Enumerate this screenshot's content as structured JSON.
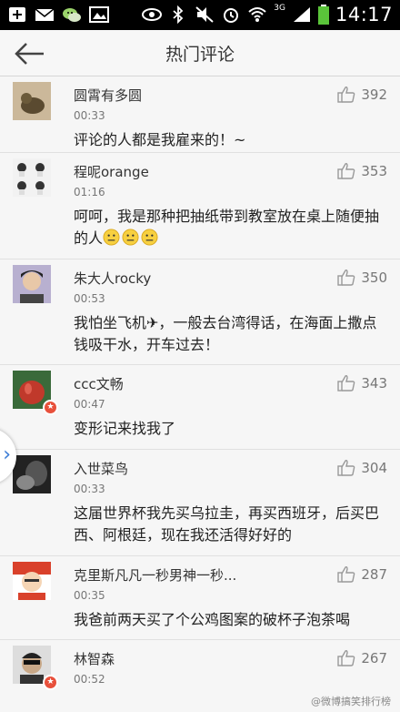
{
  "status_bar": {
    "time": "14:17",
    "network": "3G",
    "left_icons": [
      "add-icon",
      "mail-icon",
      "wechat-icon",
      "image-icon"
    ],
    "right_icons": [
      "eye-icon",
      "bluetooth-icon",
      "mute-icon",
      "alarm-icon",
      "wifi-icon",
      "signal-icon",
      "battery-icon"
    ]
  },
  "header": {
    "title": "热门评论",
    "back_icon": "back-arrow-icon"
  },
  "comments": [
    {
      "user": "圆霄有多圆",
      "time": "00:33",
      "text": "评论的人都是我雇来的！~",
      "likes": "392",
      "verified": false,
      "avatar_color": "#8a8060"
    },
    {
      "user": "程呢orange",
      "time": "01:16",
      "text": "呵呵，我是那种把抽纸带到教室放在桌上随便抽的人",
      "emojis": 3,
      "likes": "353",
      "verified": false,
      "avatar_color": "#e8e8e8"
    },
    {
      "user": "朱大人rocky",
      "time": "00:53",
      "text": "我怕坐飞机✈，一般去台湾得话，在海面上撒点钱吸干水，开车过去！",
      "likes": "350",
      "verified": false,
      "avatar_color": "#7a6a9a"
    },
    {
      "user": "ccc文畅",
      "time": "00:47",
      "text": "变形记来找我了",
      "likes": "343",
      "verified": true,
      "avatar_color": "#c0392b"
    },
    {
      "user": "入世菜鸟",
      "time": "00:33",
      "text": "这届世界杯我先买乌拉圭，再买西班牙，后买巴西、阿根廷，现在我还活得好好的",
      "likes": "304",
      "verified": false,
      "avatar_color": "#333333"
    },
    {
      "user": "克里斯凡凡一秒男神一秒...",
      "time": "00:35",
      "text": "我爸前两天买了个公鸡图案的破杯子泡茶喝",
      "likes": "287",
      "verified": false,
      "avatar_color": "#d9412b"
    },
    {
      "user": "林智森",
      "time": "00:52",
      "text": "",
      "likes": "267",
      "verified": true,
      "avatar_color": "#555555"
    }
  ],
  "watermark": "@微博搞笑排行榜",
  "side_tab_icon": "chevron-right-icon",
  "colors": {
    "accent": "#3a7bd5",
    "verified_badge": "#e8503b",
    "text": "#222222",
    "muted": "#777777"
  }
}
